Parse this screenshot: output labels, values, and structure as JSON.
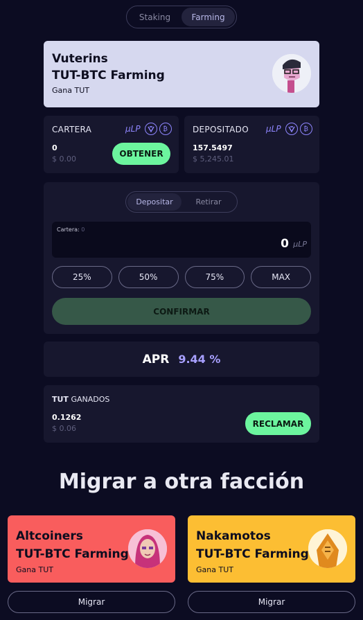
{
  "top_tabs": {
    "staking": "Staking",
    "farming": "Farming"
  },
  "pool": {
    "name": "Vuterins",
    "pair": "TUT-BTC Farming",
    "earn": "Gana TUT"
  },
  "wallet": {
    "label": "CARTERA",
    "lp_unit": "µLP",
    "amount": "0",
    "usd": "$ 0.00",
    "get_button": "OBTENER"
  },
  "deposited": {
    "label": "DEPOSITADO",
    "lp_unit": "µLP",
    "amount": "157.5497",
    "usd": "$ 5,245.01"
  },
  "form": {
    "tabs": {
      "deposit": "Depositar",
      "withdraw": "Retirar"
    },
    "wallet_label": "Cartera:",
    "wallet_value": "0",
    "amount": "0",
    "unit": "µLP",
    "percent_buttons": [
      "25%",
      "50%",
      "75%",
      "MAX"
    ],
    "confirm": "CONFIRMAR"
  },
  "apr": {
    "label": "APR",
    "value": "9.44 %"
  },
  "earned": {
    "token": "TUT",
    "label": "GANADOS",
    "amount": "0.1262",
    "usd": "$ 0.06",
    "claim": "RECLAMAR"
  },
  "migrate": {
    "title": "Migrar a otra facción",
    "factions": [
      {
        "name": "Altcoiners",
        "pair": "TUT-BTC Farming",
        "earn": "Gana TUT",
        "button": "Migrar",
        "color": "#f95d5d"
      },
      {
        "name": "Nakamotos",
        "pair": "TUT-BTC Farming",
        "earn": "Gana TUT",
        "button": "Migrar",
        "color": "#fcbe33"
      }
    ]
  },
  "colors": {
    "accent_green": "#6cf59e",
    "accent_purple": "#8f86ff",
    "background": "#0c0c22",
    "card": "#17172e"
  }
}
